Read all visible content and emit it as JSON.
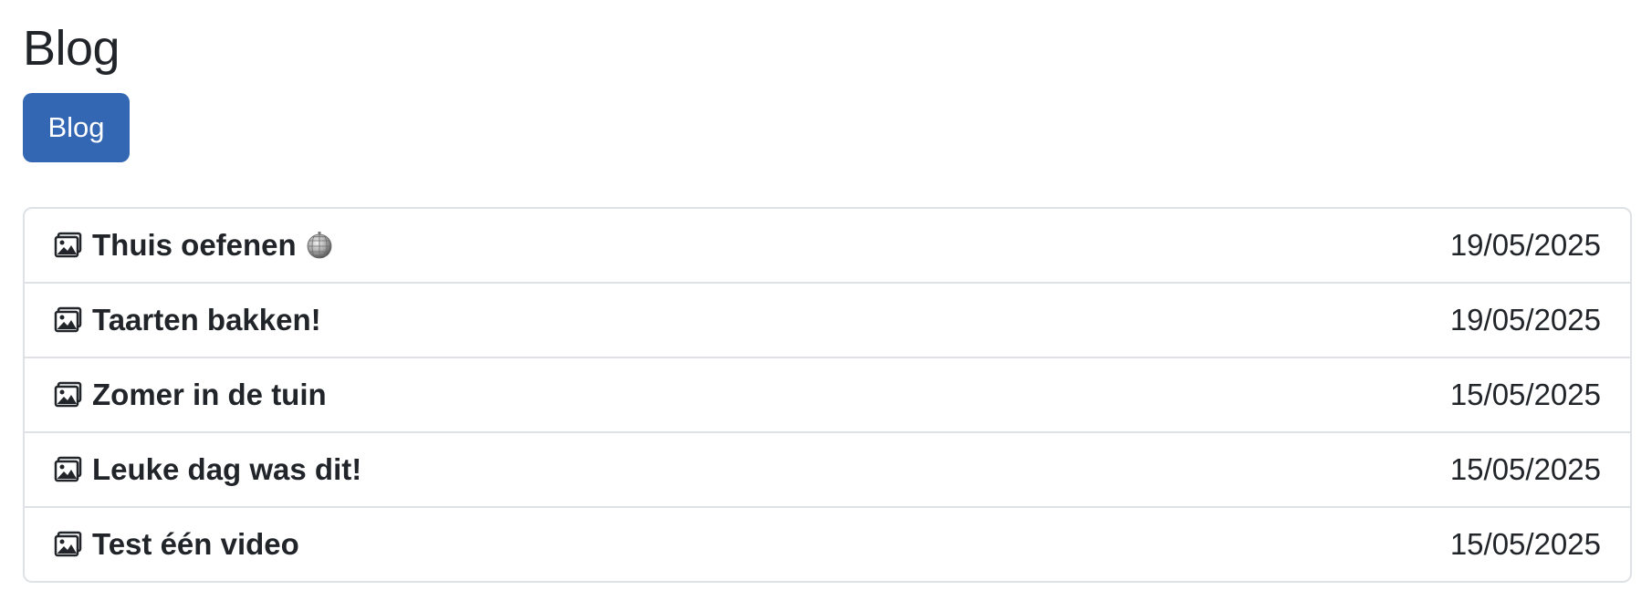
{
  "header": {
    "title": "Blog"
  },
  "toolbar": {
    "blog_button_label": "Blog",
    "accent_color": "#3366b3"
  },
  "posts": [
    {
      "title": "Thuis oefenen",
      "date": "19/05/2025",
      "icon": "image-icon",
      "extra_icon": "disco-ball-icon"
    },
    {
      "title": "Taarten bakken!",
      "date": "19/05/2025",
      "icon": "image-icon"
    },
    {
      "title": "Zomer in de tuin",
      "date": "15/05/2025",
      "icon": "image-icon"
    },
    {
      "title": "Leuke dag was dit!",
      "date": "15/05/2025",
      "icon": "image-icon"
    },
    {
      "title": "Test één video",
      "date": "15/05/2025",
      "icon": "image-icon"
    }
  ]
}
